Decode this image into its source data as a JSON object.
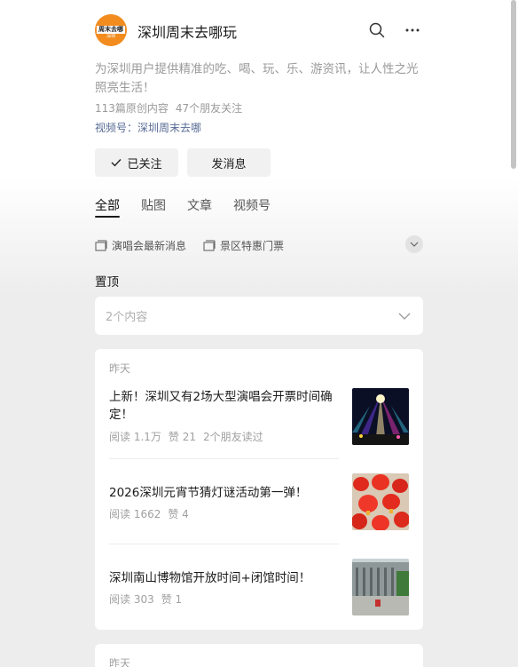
{
  "account": {
    "name": "深圳周末去哪玩",
    "logo_text": [
      "周末去哪",
      "深圳"
    ],
    "description": "为深圳用户提供精准的吃、喝、玩、乐、游资讯，让人性之光照亮生活！",
    "original_count": "113篇原创内容",
    "friends_following": "47个朋友关注",
    "channel": "视频号：深圳周末去哪"
  },
  "buttons": {
    "followed": "已关注",
    "message": "发消息"
  },
  "tabs": [
    "全部",
    "贴图",
    "文章",
    "视频号"
  ],
  "tags": [
    "演唱会最新消息",
    "景区特惠门票"
  ],
  "pinned": {
    "title": "置顶",
    "summary": "2个内容"
  },
  "feed": {
    "date": "昨天",
    "articles": [
      {
        "title": "上新！深圳又有2场大型演唱会开票时间确定！",
        "reads": "阅读 1.1万",
        "likes": "赞 21",
        "friends": "2个朋友读过",
        "thumb": "concert-stage-image"
      },
      {
        "title": "2026深圳元宵节猜灯谜活动第一弹！",
        "reads": "阅读 1662",
        "likes": "赞 4",
        "thumb": "red-lanterns-image"
      },
      {
        "title": "深圳南山博物馆开放时间+闭馆时间！",
        "reads": "阅读 303",
        "likes": "赞 1",
        "thumb": "museum-building-image"
      }
    ]
  },
  "feed2": {
    "date": "昨天"
  },
  "colors": {
    "link": "#576b95",
    "logo_orange": "#f28c1f",
    "background": "#ededed"
  }
}
